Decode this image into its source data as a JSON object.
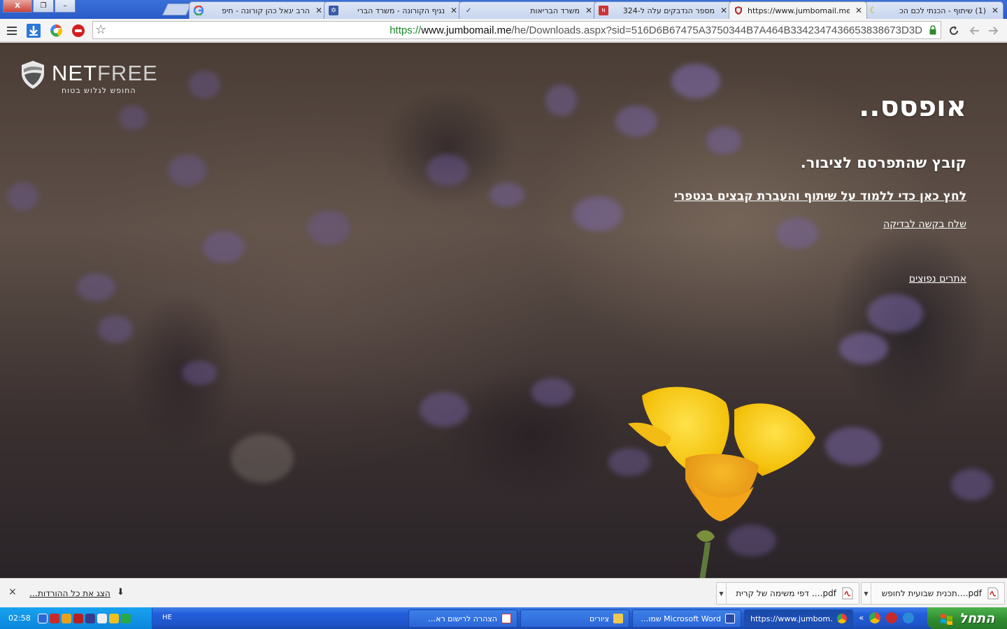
{
  "tabs": [
    {
      "label": "(1) שיתוף - הכנתי לכם הכ",
      "favicon": "moon-icon",
      "active": false
    },
    {
      "label": "https://www.jumbomail.me/h",
      "favicon": "shield-icon",
      "active": true
    },
    {
      "label": "מספר הנדבקים עלה ל-324",
      "favicon": "news-icon",
      "active": false
    },
    {
      "label": "משרד הבריאות",
      "favicon": "check-icon",
      "active": false
    },
    {
      "label": "נגיף הקורונה - משרד הברי",
      "favicon": "emblem-icon",
      "active": false
    },
    {
      "label": "הרב יגאל כהן קורונה - חיפ",
      "favicon": "google-icon",
      "active": false
    }
  ],
  "window_buttons": {
    "close": "X",
    "restore": "❐",
    "minimize": "–"
  },
  "omnibox": {
    "scheme": "https://",
    "host": "www.jumbomail.me",
    "path": "/he/Downloads.aspx?sid=516D6B67475A3750344B7A464B3342347436653838673D3D"
  },
  "page": {
    "logo_word_a": "NET",
    "logo_word_b": "FREE",
    "logo_tagline": "החופש לגלוש בטוח",
    "headline": "אופסס..",
    "subline": "קובץ שהתפרסם לציבור.",
    "learn_link": "לחץ כאן כדי ללמוד על שיתוף והעברת קבצים בנטפרי",
    "request_link": "שלח בקשה לבדיקה",
    "sites_link": "אתרים נפוצים"
  },
  "downloads": {
    "items": [
      {
        "name": "pdf.…תכנית שבועית לחופש"
      },
      {
        "name": "pdf.… דפי משימה של קרית"
      }
    ],
    "show_all": "הצג את כל ההורדות…",
    "close": "×"
  },
  "taskbar": {
    "clock": "02:58",
    "lang": "HE",
    "start_label": "התחל",
    "tasks": [
      {
        "name": "https://www.jumbom…",
        "icon": "chrome-icon",
        "active": true
      },
      {
        "name": "Microsoft Word שמו…",
        "icon": "word-icon",
        "active": false
      },
      {
        "name": "ציורים",
        "icon": "folder-icon",
        "active": false
      },
      {
        "name": "הצהרה לרישום רא…",
        "icon": "pdf-icon",
        "active": false
      }
    ],
    "quicklaunch_chevron": "«"
  },
  "colors": {
    "taskbar_blue": "#245edb",
    "start_green": "#2e8a2e",
    "flower_yellow": "#f4c20d",
    "url_green": "#1a8a2a"
  }
}
